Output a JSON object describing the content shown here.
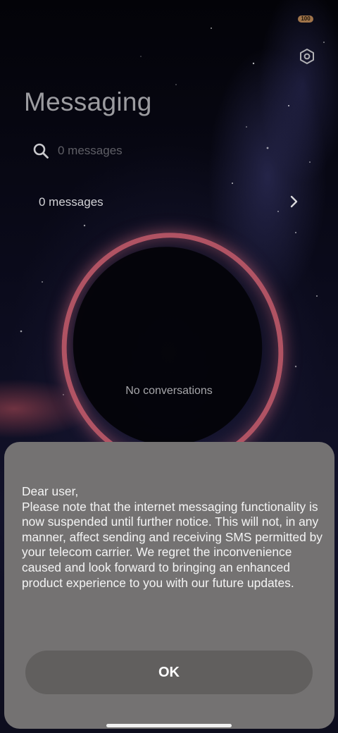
{
  "status_bar": {
    "battery_level": "100",
    "battery_color": "#a0744a"
  },
  "header": {
    "title": "Messaging",
    "settings_icon": "settings-hexagon-icon"
  },
  "search": {
    "placeholder": "0 messages",
    "icon": "search-icon"
  },
  "messages_row": {
    "label": "0 messages",
    "icon": "chevron-right-icon"
  },
  "empty_state": {
    "text": "No conversations"
  },
  "dialog": {
    "body": "Dear user,\nPlease note that the internet messaging functionality is now suspended until further notice. This will not, in any manner, affect sending and receiving SMS permitted by your telecom carrier. We regret the inconvenience caused and look forward to bringing an enhanced product experience to you with our future updates.",
    "ok_label": "OK",
    "background": "#747272",
    "button_color": "#615f5e"
  }
}
